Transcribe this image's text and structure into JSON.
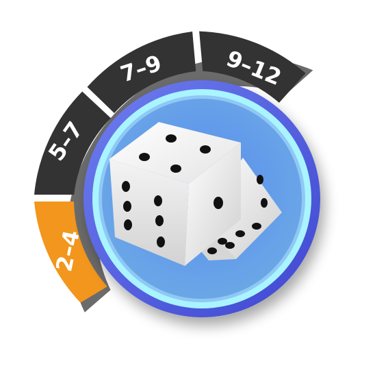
{
  "dice_roll_widget": {
    "segments": [
      {
        "label": "2–4",
        "active": true
      },
      {
        "label": "5–7",
        "active": false
      },
      {
        "label": "7–9",
        "active": false
      },
      {
        "label": "9–12",
        "active": false
      }
    ],
    "center_icon": "dice-icon",
    "colors": {
      "segment_active": "#f2961d",
      "segment_inactive": "#333333",
      "segment_track": "#6b6b6b",
      "button_ring_outer": "#4f5fe0",
      "button_ring_glow": "#a9f4ff",
      "button_fill_top": "#5b8ff0",
      "button_fill_bottom": "#6ab0e8",
      "die_face": "#f5f5f5",
      "pip": "#111111"
    }
  }
}
